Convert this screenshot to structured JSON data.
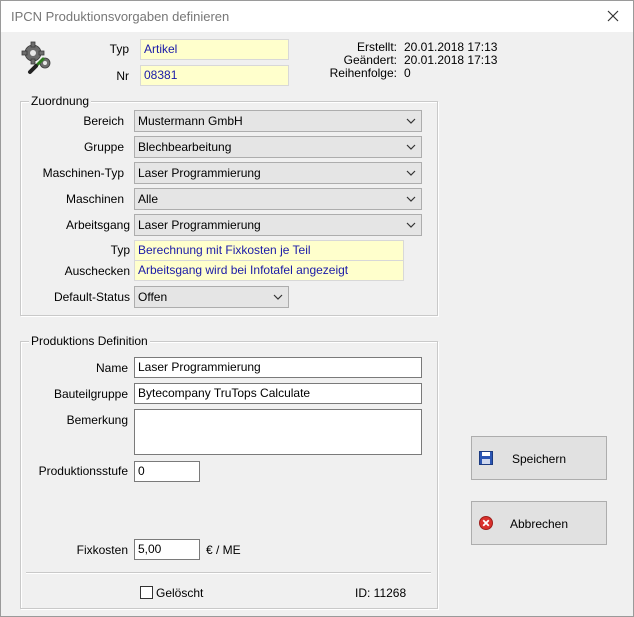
{
  "window": {
    "title": "IPCN Produktionsvorgaben definieren"
  },
  "header": {
    "typ_label": "Typ",
    "typ_value": "Artikel",
    "nr_label": "Nr",
    "nr_value": "08381",
    "erstellt_label": "Erstellt:",
    "erstellt_value": "20.01.2018 17:13",
    "geaendert_label": "Geändert:",
    "geaendert_value": "20.01.2018 17:13",
    "reihenfolge_label": "Reihenfolge:",
    "reihenfolge_value": "0"
  },
  "zuordnung": {
    "title": "Zuordnung",
    "bereich_label": "Bereich",
    "bereich_value": "Mustermann GmbH",
    "gruppe_label": "Gruppe",
    "gruppe_value": "Blechbearbeitung",
    "maschinen_typ_label": "Maschinen-Typ",
    "maschinen_typ_value": "Laser Programmierung",
    "maschinen_label": "Maschinen",
    "maschinen_value": "Alle",
    "arbeitsgang_label": "Arbeitsgang",
    "arbeitsgang_value": "Laser Programmierung",
    "typ_label": "Typ",
    "typ_value": "Berechnung mit Fixkosten je Teil",
    "auschecken_label": "Auschecken",
    "auschecken_value": "Arbeitsgang wird bei Infotafel angezeigt",
    "default_status_label": "Default-Status",
    "default_status_value": "Offen"
  },
  "produktion": {
    "title": "Produktions Definition",
    "name_label": "Name",
    "name_value": "Laser Programmierung",
    "bauteilgruppe_label": "Bauteilgruppe",
    "bauteilgruppe_value": "Bytecompany TruTops Calculate",
    "bemerkung_label": "Bemerkung",
    "bemerkung_value": "",
    "produktionsstufe_label": "Produktionsstufe",
    "produktionsstufe_value": "0",
    "fixkosten_label": "Fixkosten",
    "fixkosten_value": "5,00",
    "fixkosten_unit": "€ / ME",
    "geloescht_label": "Gelöscht",
    "id_label": "ID: 11268"
  },
  "buttons": {
    "save_label": "Speichern",
    "cancel_label": "Abbrechen"
  },
  "icons": {
    "settings": "gears-wrench-icon",
    "save": "floppy-disk-icon",
    "cancel": "red-x-icon",
    "chevron": "chevron-down-icon",
    "close": "close-icon"
  },
  "colors": {
    "readonly_bg": "#ffffcc",
    "readonly_text": "#1a1aa8",
    "cancel_red": "#d9302c",
    "save_blue": "#2b55b3"
  }
}
